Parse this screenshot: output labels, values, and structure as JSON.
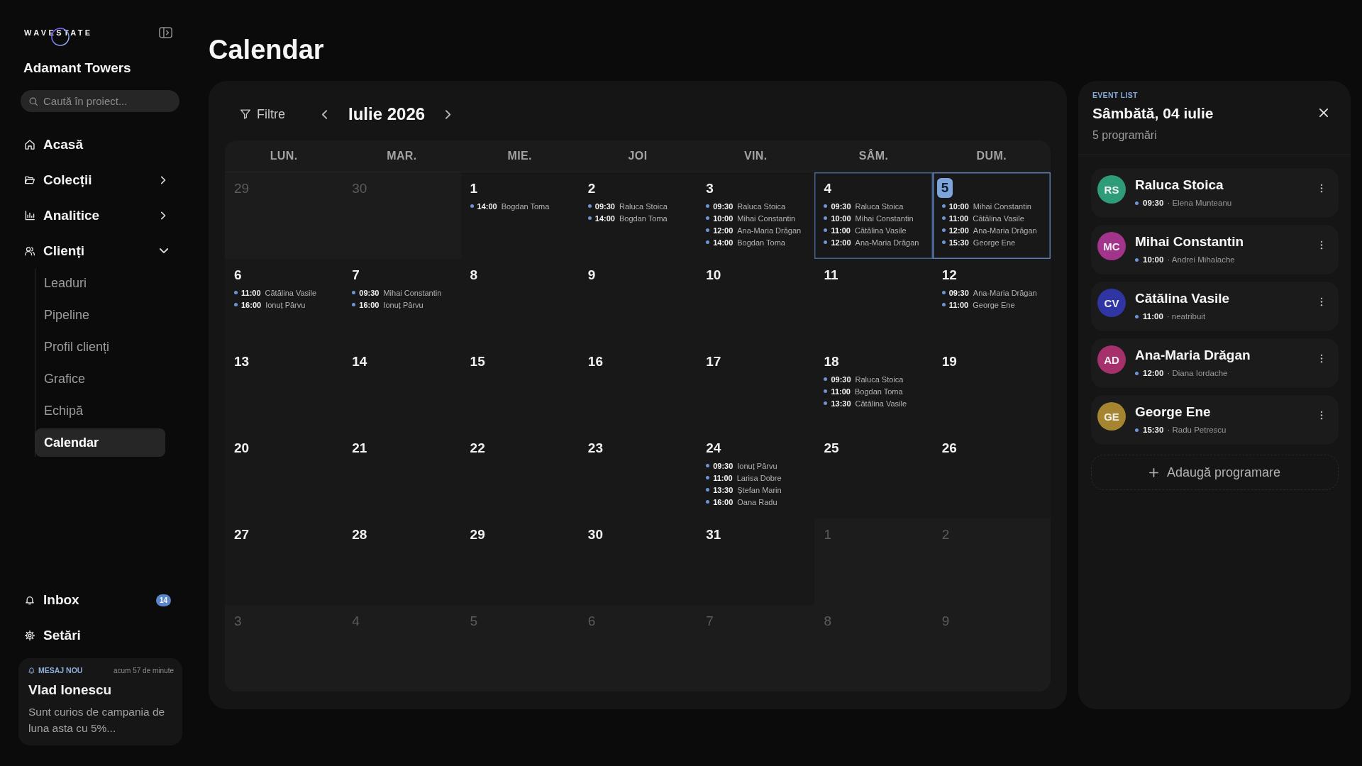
{
  "sidebar": {
    "logo": "WAVESTATE",
    "project": "Adamant Towers",
    "search": {
      "placeholder": "Caută în proiect..."
    },
    "nav": [
      {
        "label": "Acasă",
        "kind": "link",
        "selected": false
      },
      {
        "label": "Colecții",
        "kind": "group",
        "expanded": false,
        "selected": false
      },
      {
        "label": "Analitice",
        "kind": "group",
        "expanded": false,
        "selected": false
      },
      {
        "label": "Clienți",
        "kind": "group",
        "expanded": true,
        "selected": false,
        "children": [
          {
            "label": "Leaduri",
            "selected": false
          },
          {
            "label": "Pipeline",
            "selected": false
          },
          {
            "label": "Profil clienți",
            "selected": false
          },
          {
            "label": "Grafice",
            "selected": false
          },
          {
            "label": "Echipă",
            "selected": false
          },
          {
            "label": "Calendar",
            "selected": true
          }
        ]
      }
    ],
    "bottom": [
      {
        "label": "Inbox",
        "badge": "14"
      },
      {
        "label": "Setări"
      }
    ],
    "notification": {
      "tag": "MESAJ NOU",
      "time": "acum 57 de minute",
      "sender": "Vlad Ionescu",
      "message": "Sunt curios de campania de luna asta cu 5%..."
    }
  },
  "page": {
    "title": "Calendar"
  },
  "calendar": {
    "filter": "Filtre",
    "month": "Iulie 2026",
    "weekdays": [
      "LUN.",
      "MAR.",
      "MIE.",
      "JOI",
      "VIN.",
      "SÂM.",
      "DUM."
    ],
    "weeks": [
      [
        {
          "day": "29",
          "in_month": false,
          "selected": false,
          "today": false
        },
        {
          "day": "30",
          "in_month": false,
          "selected": false,
          "today": false
        },
        {
          "day": "1",
          "in_month": true,
          "selected": false,
          "today": false,
          "events": [
            {
              "time": "14:00",
              "client": "Bogdan Toma"
            }
          ]
        },
        {
          "day": "2",
          "in_month": true,
          "selected": false,
          "today": false,
          "events": [
            {
              "time": "09:30",
              "client": "Raluca Stoica"
            },
            {
              "time": "14:00",
              "client": "Bogdan Toma"
            }
          ]
        },
        {
          "day": "3",
          "in_month": true,
          "selected": false,
          "today": false,
          "events": [
            {
              "time": "09:30",
              "client": "Raluca Stoica"
            },
            {
              "time": "10:00",
              "client": "Mihai Constantin"
            },
            {
              "time": "12:00",
              "client": "Ana-Maria Drăgan"
            },
            {
              "time": "14:00",
              "client": "Bogdan Toma"
            }
          ]
        },
        {
          "day": "4",
          "in_month": true,
          "selected": true,
          "today": false,
          "events": [
            {
              "time": "09:30",
              "client": "Raluca Stoica"
            },
            {
              "time": "10:00",
              "client": "Mihai Constantin"
            },
            {
              "time": "11:00",
              "client": "Cătălina Vasile"
            },
            {
              "time": "12:00",
              "client": "Ana-Maria Drăgan"
            }
          ]
        },
        {
          "day": "5",
          "in_month": true,
          "selected": false,
          "today": true,
          "events": [
            {
              "time": "10:00",
              "client": "Mihai Constantin"
            },
            {
              "time": "11:00",
              "client": "Cătălina Vasile"
            },
            {
              "time": "12:00",
              "client": "Ana-Maria Drăgan"
            },
            {
              "time": "15:30",
              "client": "George Ene"
            }
          ]
        }
      ],
      [
        {
          "day": "6",
          "in_month": true,
          "selected": false,
          "today": false,
          "events": [
            {
              "time": "11:00",
              "client": "Cătălina Vasile"
            },
            {
              "time": "16:00",
              "client": "Ionuț Pârvu"
            }
          ]
        },
        {
          "day": "7",
          "in_month": true,
          "selected": false,
          "today": false,
          "events": [
            {
              "time": "09:30",
              "client": "Mihai Constantin"
            },
            {
              "time": "16:00",
              "client": "Ionuț Pârvu"
            }
          ]
        },
        {
          "day": "8",
          "in_month": true,
          "selected": false,
          "today": false
        },
        {
          "day": "9",
          "in_month": true,
          "selected": false,
          "today": false
        },
        {
          "day": "10",
          "in_month": true,
          "selected": false,
          "today": false
        },
        {
          "day": "11",
          "in_month": true,
          "selected": false,
          "today": false
        },
        {
          "day": "12",
          "in_month": true,
          "selected": false,
          "today": false,
          "events": [
            {
              "time": "09:30",
              "client": "Ana-Maria Drăgan"
            },
            {
              "time": "11:00",
              "client": "George Ene"
            }
          ]
        }
      ],
      [
        {
          "day": "13",
          "in_month": true,
          "selected": false,
          "today": false
        },
        {
          "day": "14",
          "in_month": true,
          "selected": false,
          "today": false
        },
        {
          "day": "15",
          "in_month": true,
          "selected": false,
          "today": false
        },
        {
          "day": "16",
          "in_month": true,
          "selected": false,
          "today": false
        },
        {
          "day": "17",
          "in_month": true,
          "selected": false,
          "today": false
        },
        {
          "day": "18",
          "in_month": true,
          "selected": false,
          "today": false,
          "events": [
            {
              "time": "09:30",
              "client": "Raluca Stoica"
            },
            {
              "time": "11:00",
              "client": "Bogdan Toma"
            },
            {
              "time": "13:30",
              "client": "Cătălina Vasile"
            }
          ]
        },
        {
          "day": "19",
          "in_month": true,
          "selected": false,
          "today": false
        }
      ],
      [
        {
          "day": "20",
          "in_month": true,
          "selected": false,
          "today": false
        },
        {
          "day": "21",
          "in_month": true,
          "selected": false,
          "today": false
        },
        {
          "day": "22",
          "in_month": true,
          "selected": false,
          "today": false
        },
        {
          "day": "23",
          "in_month": true,
          "selected": false,
          "today": false
        },
        {
          "day": "24",
          "in_month": true,
          "selected": false,
          "today": false,
          "events": [
            {
              "time": "09:30",
              "client": "Ionuț Pârvu"
            },
            {
              "time": "11:00",
              "client": "Larisa Dobre"
            },
            {
              "time": "13:30",
              "client": "Ștefan Marin"
            },
            {
              "time": "16:00",
              "client": "Oana Radu"
            }
          ]
        },
        {
          "day": "25",
          "in_month": true,
          "selected": false,
          "today": false
        },
        {
          "day": "26",
          "in_month": true,
          "selected": false,
          "today": false
        }
      ],
      [
        {
          "day": "27",
          "in_month": true,
          "selected": false,
          "today": false
        },
        {
          "day": "28",
          "in_month": true,
          "selected": false,
          "today": false
        },
        {
          "day": "29",
          "in_month": true,
          "selected": false,
          "today": false
        },
        {
          "day": "30",
          "in_month": true,
          "selected": false,
          "today": false
        },
        {
          "day": "31",
          "in_month": true,
          "selected": false,
          "today": false
        },
        {
          "day": "1",
          "in_month": false,
          "selected": false,
          "today": false
        },
        {
          "day": "2",
          "in_month": false,
          "selected": false,
          "today": false
        }
      ],
      [
        {
          "day": "3",
          "in_month": false,
          "selected": false,
          "today": false
        },
        {
          "day": "4",
          "in_month": false,
          "selected": false,
          "today": false
        },
        {
          "day": "5",
          "in_month": false,
          "selected": false,
          "today": false
        },
        {
          "day": "6",
          "in_month": false,
          "selected": false,
          "today": false
        },
        {
          "day": "7",
          "in_month": false,
          "selected": false,
          "today": false
        },
        {
          "day": "8",
          "in_month": false,
          "selected": false,
          "today": false
        },
        {
          "day": "9",
          "in_month": false,
          "selected": false,
          "today": false
        }
      ]
    ]
  },
  "event_list": {
    "label": "EVENT LIST",
    "title": "Sâmbătă, 04 iulie",
    "count": "5 programări",
    "items": [
      {
        "initials": "RS",
        "name": "Raluca Stoica",
        "time": "09:30",
        "assignee": "· Elena Munteanu",
        "color": "#2f9c79"
      },
      {
        "initials": "MC",
        "name": "Mihai Constantin",
        "time": "10:00",
        "assignee": "· Andrei Mihalache",
        "color": "#a3348c"
      },
      {
        "initials": "CV",
        "name": "Cătălina Vasile",
        "time": "11:00",
        "assignee": "· neatribuit",
        "color": "#2f36a4"
      },
      {
        "initials": "AD",
        "name": "Ana-Maria Drăgan",
        "time": "12:00",
        "assignee": "· Diana Iordache",
        "color": "#a5306c"
      },
      {
        "initials": "GE",
        "name": "George Ene",
        "time": "15:30",
        "assignee": "· Radu Petrescu",
        "color": "#a5852f"
      }
    ],
    "add_button": "Adaugă programare"
  }
}
